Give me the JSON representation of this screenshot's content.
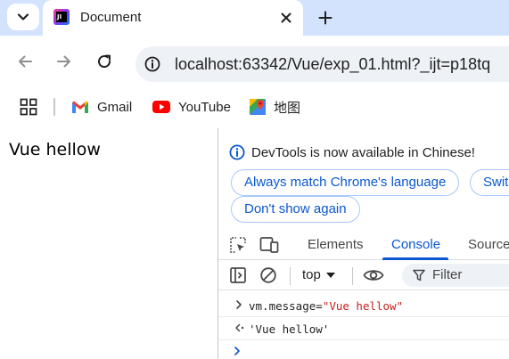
{
  "browser": {
    "tab": {
      "title": "Document",
      "favicon_text": "JI"
    },
    "omnibox": {
      "url": "localhost:63342/Vue/exp_01.html?_ijt=p18tq"
    },
    "bookmarks": [
      {
        "label": "Gmail",
        "icon": "gmail-icon"
      },
      {
        "label": "YouTube",
        "icon": "youtube-icon"
      },
      {
        "label": "地图",
        "icon": "maps-icon"
      }
    ]
  },
  "page": {
    "text": "Vue hellow"
  },
  "devtools": {
    "infobar": {
      "message": "DevTools is now available in Chinese!",
      "buttons": [
        "Always match Chrome's language",
        "Switch",
        "Don't show again"
      ]
    },
    "tabs": [
      "Elements",
      "Console",
      "Source"
    ],
    "active_tab": "Console",
    "console_toolbar": {
      "context": "top",
      "filter_placeholder": "Filter"
    },
    "console": [
      {
        "kind": "input",
        "prefix": "vm.message=",
        "string": "\"Vue hellow\""
      },
      {
        "kind": "output",
        "string": "'Vue hellow'"
      }
    ]
  },
  "colors": {
    "tabstrip": "#d3e3fd",
    "accent": "#0b57d0",
    "string": "#c5221f",
    "omnibox": "#eef1f6"
  }
}
